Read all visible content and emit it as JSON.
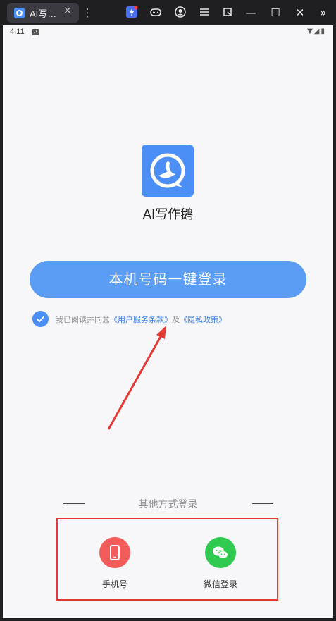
{
  "browser": {
    "tab_title": "AI写…",
    "tab_close": "×",
    "menu_icon": "⋮",
    "window_controls": [
      "—",
      "☐",
      "✕",
      "»"
    ]
  },
  "statusbar": {
    "time": "4:11",
    "badge": "A",
    "icons": "▼◢▮"
  },
  "app": {
    "name": "AI写作鹅",
    "login_button": "本机号码一键登录",
    "agree_prefix": "我已阅读并同意",
    "terms_link": "《用户服务条款》",
    "agree_join": "及",
    "privacy_link": "《隐私政策》",
    "other_methods": "其他方式登录",
    "options": [
      {
        "label": "手机号",
        "icon": "phone-icon",
        "color": "#f45b5b"
      },
      {
        "label": "微信登录",
        "icon": "wechat-icon",
        "color": "#2fca4f"
      }
    ]
  },
  "colors": {
    "accent": "#4a8ef6",
    "button": "#5b9df5",
    "annotation": "#e53935"
  }
}
